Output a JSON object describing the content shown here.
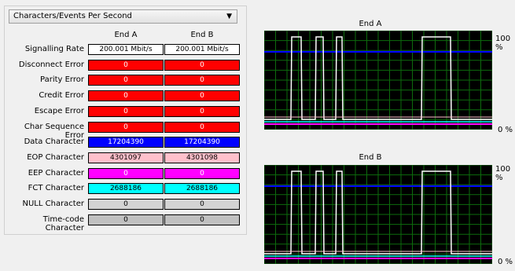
{
  "stats": {
    "dropdown_value": "Characters/Events Per Second",
    "col_a": "End A",
    "col_b": "End B",
    "rows": [
      {
        "label": "Signalling Rate",
        "a": "200.001 Mbit/s",
        "b": "200.001 Mbit/s",
        "color": "#ffffff",
        "text": "#000000"
      },
      {
        "label": "Disconnect Error",
        "a": "0",
        "b": "0",
        "color": "#ff0000",
        "text": "#ffffff"
      },
      {
        "label": "Parity Error",
        "a": "0",
        "b": "0",
        "color": "#ff0000",
        "text": "#ffffff"
      },
      {
        "label": "Credit Error",
        "a": "0",
        "b": "0",
        "color": "#ff0000",
        "text": "#ffffff"
      },
      {
        "label": "Escape Error",
        "a": "0",
        "b": "0",
        "color": "#ff0000",
        "text": "#ffffff"
      },
      {
        "label": "Char Sequence Error",
        "a": "0",
        "b": "0",
        "color": "#ff0000",
        "text": "#ffffff"
      },
      {
        "label": "Data Character",
        "a": "17204390",
        "b": "17204390",
        "color": "#0000ff",
        "text": "#ffffff"
      },
      {
        "label": "EOP Character",
        "a": "4301097",
        "b": "4301098",
        "color": "#ffc0cb",
        "text": "#000000"
      },
      {
        "label": "EEP Character",
        "a": "0",
        "b": "0",
        "color": "#ff00ff",
        "text": "#ffffff"
      },
      {
        "label": "FCT Character",
        "a": "2688186",
        "b": "2688186",
        "color": "#00ffff",
        "text": "#000000"
      },
      {
        "label": "NULL Character",
        "a": "0",
        "b": "0",
        "color": "#d3d3d3",
        "text": "#000000"
      },
      {
        "label": "Time-code Character",
        "a": "0",
        "b": "0",
        "color": "#c0c0c0",
        "text": "#000000"
      }
    ]
  },
  "charts": {
    "end_a": {
      "title": "End A",
      "y_max_label": "100 %",
      "y_min_label": "0 %"
    },
    "end_b": {
      "title": "End B",
      "y_max_label": "100 %",
      "y_min_label": "0 %"
    }
  }
}
